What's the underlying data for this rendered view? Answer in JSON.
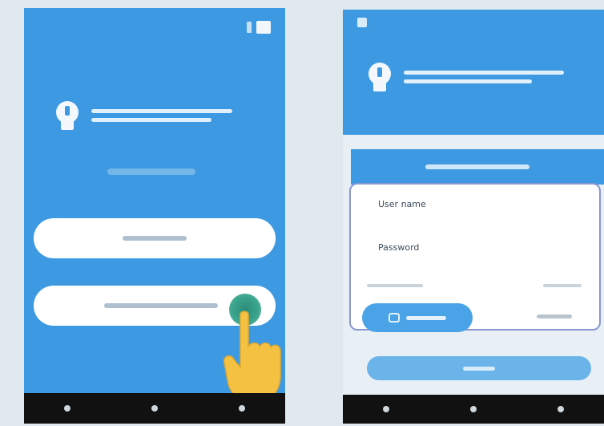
{
  "phone2": {
    "login_form": {
      "username_label": "User name",
      "password_label": "Password"
    }
  }
}
